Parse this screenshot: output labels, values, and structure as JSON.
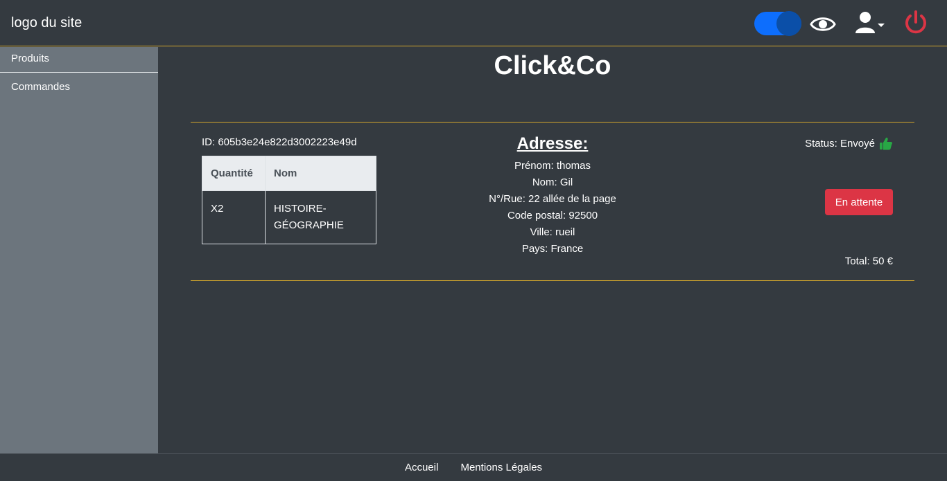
{
  "header": {
    "logo_text": "logo du site",
    "toggle_on": true,
    "icons": [
      "eye-icon",
      "user-icon",
      "chevron-down-icon",
      "power-icon"
    ],
    "colors": {
      "toggle": "#0d6efd",
      "power": "#dc3545",
      "accent_line": "#d4a72c"
    }
  },
  "sidebar": {
    "items": [
      {
        "label": "Produits"
      },
      {
        "label": "Commandes"
      }
    ]
  },
  "main": {
    "title": "Click&Co",
    "order": {
      "id_text": "ID: 605b3e24e822d3002223e49d",
      "table": {
        "headers": [
          "Quantité",
          "Nom"
        ],
        "rows": [
          {
            "qty": "X2",
            "name": "HISTOIRE-GÉOGRAPHIE"
          }
        ]
      },
      "address": {
        "title": "Adresse:",
        "lines": [
          "Prénom: thomas",
          "Nom: Gil",
          "N°/Rue: 22 allée de la page",
          "Code postal: 92500",
          "Ville: rueil",
          "Pays: France"
        ]
      },
      "status_text": "Status: Envoyé",
      "status_icon": "thumbs-up-icon",
      "status_color": "#28a745",
      "pending_button": "En attente",
      "total_text": "Total: 50 €"
    }
  },
  "footer": {
    "links": [
      "Accueil",
      "Mentions Légales"
    ]
  }
}
